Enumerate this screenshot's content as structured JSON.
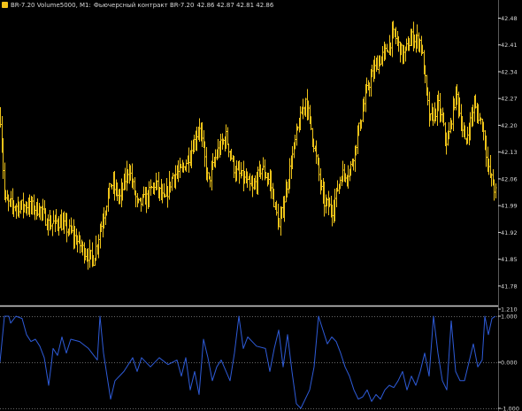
{
  "header": {
    "symbol_text": "BR-7.20 Volume5000, M1:",
    "description": "Фьючерсный контракт BR-7.20",
    "quote": "42.86 42.87 42.81 42.86"
  },
  "colors": {
    "background": "#000000",
    "bars": "#f0c419",
    "indicator": "#2e5bd8",
    "axis_text": "#d8d8d8",
    "separator": "#cfcfcf",
    "dotted_levels": "#8a8a8a"
  },
  "chart_data": [
    {
      "type": "bar",
      "style": "ohlc",
      "price_ticks": [
        "42.48",
        "42.41",
        "42.34",
        "42.27",
        "42.20",
        "42.13",
        "42.06",
        "41.99",
        "41.92",
        "41.85",
        "41.78"
      ],
      "ylim": [
        41.745,
        42.495
      ],
      "anchors": [
        [
          0,
          42.22
        ],
        [
          5,
          42.0
        ],
        [
          15,
          41.99
        ],
        [
          30,
          41.99
        ],
        [
          45,
          41.98
        ],
        [
          55,
          41.94
        ],
        [
          65,
          41.95
        ],
        [
          80,
          41.92
        ],
        [
          95,
          41.87
        ],
        [
          105,
          41.85
        ],
        [
          115,
          41.95
        ],
        [
          125,
          42.05
        ],
        [
          135,
          42.01
        ],
        [
          145,
          42.09
        ],
        [
          155,
          41.99
        ],
        [
          165,
          42.01
        ],
        [
          175,
          42.05
        ],
        [
          185,
          42.0
        ],
        [
          195,
          42.07
        ],
        [
          205,
          42.08
        ],
        [
          215,
          42.13
        ],
        [
          225,
          42.2
        ],
        [
          235,
          42.05
        ],
        [
          245,
          42.13
        ],
        [
          255,
          42.17
        ],
        [
          265,
          42.08
        ],
        [
          275,
          42.06
        ],
        [
          285,
          42.03
        ],
        [
          295,
          42.09
        ],
        [
          305,
          42.05
        ],
        [
          315,
          41.93
        ],
        [
          325,
          42.06
        ],
        [
          335,
          42.18
        ],
        [
          345,
          42.27
        ],
        [
          355,
          42.14
        ],
        [
          365,
          42.0
        ],
        [
          375,
          41.98
        ],
        [
          385,
          42.07
        ],
        [
          395,
          42.08
        ],
        [
          405,
          42.19
        ],
        [
          415,
          42.3
        ],
        [
          425,
          42.36
        ],
        [
          435,
          42.39
        ],
        [
          445,
          42.44
        ],
        [
          455,
          42.38
        ],
        [
          465,
          42.43
        ],
        [
          475,
          42.42
        ],
        [
          485,
          42.21
        ],
        [
          495,
          42.25
        ],
        [
          505,
          42.15
        ],
        [
          515,
          42.29
        ],
        [
          525,
          42.15
        ],
        [
          535,
          42.25
        ],
        [
          545,
          42.2
        ],
        [
          552,
          42.08
        ],
        [
          560,
          42.02
        ]
      ]
    },
    {
      "type": "line",
      "name": "",
      "level_ticks": [
        "1.210",
        "1.000",
        "0.000",
        "-1.000"
      ],
      "ylim": [
        -1.0,
        1.21
      ],
      "x": [
        0,
        5,
        10,
        12,
        18,
        25,
        30,
        35,
        40,
        45,
        50,
        55,
        58,
        60,
        65,
        70,
        75,
        80,
        90,
        100,
        110,
        113,
        117,
        125,
        130,
        140,
        150,
        155,
        160,
        170,
        180,
        190,
        200,
        205,
        210,
        215,
        220,
        225,
        230,
        235,
        240,
        245,
        250,
        260,
        265,
        270,
        275,
        280,
        290,
        300,
        305,
        310,
        315,
        320,
        325,
        330,
        335,
        340,
        345,
        350,
        355,
        360,
        365,
        370,
        375,
        380,
        385,
        390,
        395,
        400,
        405,
        410,
        415,
        420,
        425,
        430,
        435,
        440,
        445,
        450,
        455,
        460,
        465,
        470,
        475,
        480,
        485,
        490,
        495,
        500,
        505,
        510,
        515,
        520,
        525,
        530,
        535,
        540,
        545,
        548,
        552,
        556,
        560
      ],
      "values": [
        0.0,
        1.0,
        1.0,
        0.85,
        1.0,
        0.95,
        0.6,
        0.45,
        0.5,
        0.35,
        0.1,
        -0.5,
        -0.05,
        0.3,
        0.15,
        0.55,
        0.2,
        0.5,
        0.45,
        0.3,
        0.05,
        1.0,
        0.2,
        -0.8,
        -0.4,
        -0.2,
        0.1,
        -0.2,
        0.1,
        -0.1,
        0.1,
        -0.05,
        0.05,
        -0.3,
        0.1,
        -0.6,
        -0.2,
        -0.7,
        0.5,
        0.1,
        -0.4,
        -0.1,
        0.05,
        -0.4,
        0.2,
        1.0,
        0.3,
        0.55,
        0.35,
        0.3,
        -0.2,
        0.3,
        0.7,
        -0.1,
        0.6,
        -0.2,
        -0.9,
        -1.0,
        -0.8,
        -0.6,
        -0.1,
        1.0,
        0.7,
        0.4,
        0.55,
        0.45,
        0.2,
        -0.1,
        -0.3,
        -0.6,
        -0.8,
        -0.75,
        -0.6,
        -0.85,
        -0.7,
        -0.8,
        -0.6,
        -0.5,
        -0.55,
        -0.4,
        -0.2,
        -0.6,
        -0.3,
        -0.5,
        -0.2,
        0.2,
        -0.3,
        1.0,
        0.2,
        -0.4,
        -0.6,
        0.9,
        -0.2,
        -0.4,
        -0.4,
        0.0,
        0.4,
        -0.1,
        0.05,
        1.0,
        0.6,
        0.95,
        1.0
      ]
    }
  ]
}
